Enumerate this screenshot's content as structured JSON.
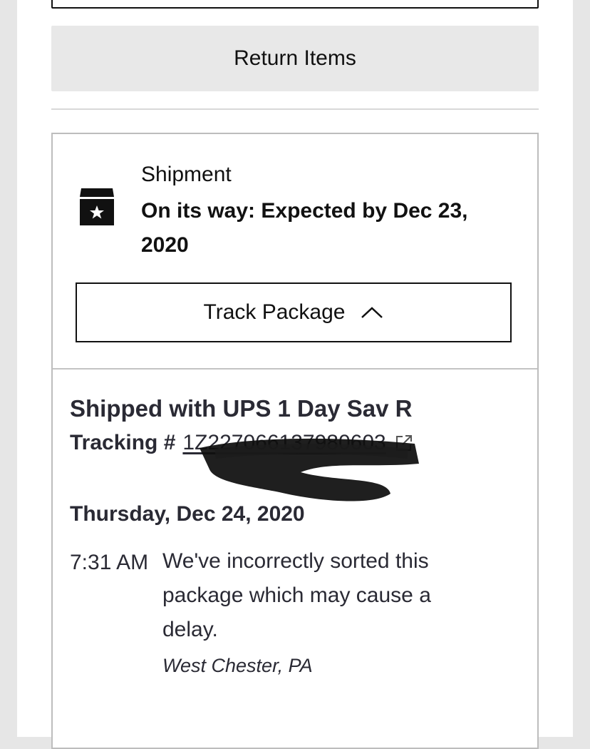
{
  "actions": {
    "return_label": "Return Items"
  },
  "shipment": {
    "label": "Shipment",
    "status": "On its way: Expected by Dec 23, 2020",
    "track_button_label": "Track Package"
  },
  "tracking": {
    "carrier_line": "Shipped with UPS 1 Day Sav R",
    "number_label": "Tracking #",
    "number": "1Z227066137980603",
    "events": [
      {
        "date": "Thursday, Dec 24, 2020",
        "time": "7:31 AM",
        "description": "We've incorrectly sorted this package which may cause a delay.",
        "location": "West Chester, PA"
      }
    ]
  },
  "icons": {
    "shipment": "package-box-star-icon",
    "track_toggle": "chevron-up-icon",
    "external_link": "external-link-icon"
  }
}
